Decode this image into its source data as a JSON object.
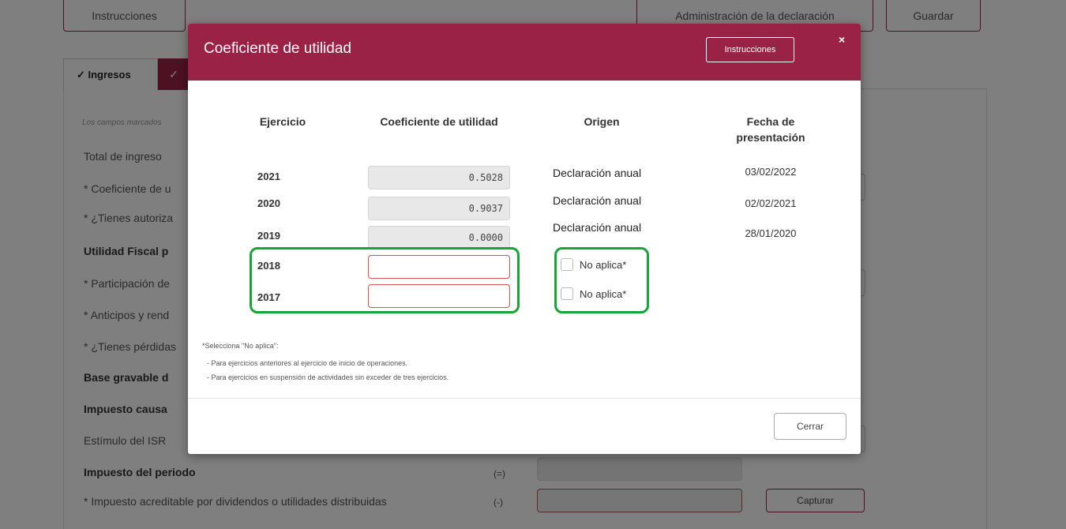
{
  "top": {
    "instrucciones": "Instrucciones",
    "administracion": "Administración de la declaración",
    "guardar": "Guardar"
  },
  "tabs": {
    "ingresos": "✓ Ingresos",
    "next": "✓"
  },
  "form": {
    "note": "Los campos marcados",
    "rows": [
      {
        "label": "Total de ingreso"
      },
      {
        "label": "* Coeficiente de u"
      },
      {
        "label": "* ¿Tienes autoriza"
      },
      {
        "label": "Utilidad Fiscal p"
      },
      {
        "label": "* Participación de"
      },
      {
        "label": "* Anticipos y rend"
      },
      {
        "label": "* ¿Tienes pérdidas"
      },
      {
        "label": "Base gravable d"
      },
      {
        "label": "Impuesto causa"
      },
      {
        "label": "Estímulo del ISR"
      },
      {
        "label": "Impuesto del periodo",
        "sign": "(=)"
      },
      {
        "label": "* Impuesto acreditable por dividendos o utilidades distribuidas",
        "sign": "(-)",
        "button": "Capturar"
      }
    ]
  },
  "modal": {
    "title": "Coeficiente de utilidad",
    "instrucciones": "Instrucciones",
    "close": "×",
    "headers": {
      "ejercicio": "Ejercicio",
      "coeficiente": "Coeficiente de utilidad",
      "origen": "Origen",
      "fecha": "Fecha de presentación"
    },
    "rows": [
      {
        "year": "2021",
        "coef": "0.5028",
        "origen": "Declaración anual",
        "fecha": "03/02/2022"
      },
      {
        "year": "2020",
        "coef": "0.9037",
        "origen": "Declaración anual",
        "fecha": "02/02/2021"
      },
      {
        "year": "2019",
        "coef": "0.0000",
        "origen": "Declaración anual",
        "fecha": "28/01/2020"
      },
      {
        "year": "2018",
        "coef": "",
        "no_aplica": "No aplica*"
      },
      {
        "year": "2017",
        "coef": "",
        "no_aplica": "No aplica*"
      }
    ],
    "footnote": {
      "title": "*Selecciona \"No aplica\":",
      "line1": "- Para ejercicios anteriores al ejercicio de inicio de operaciones.",
      "line2": "- Para ejercicios en suspensión de actividades sin exceder de tres ejercicios."
    },
    "cerrar": "Cerrar"
  },
  "colors": {
    "brand": "#9b2247",
    "highlight": "#1aa33b",
    "error": "#d9534f"
  }
}
